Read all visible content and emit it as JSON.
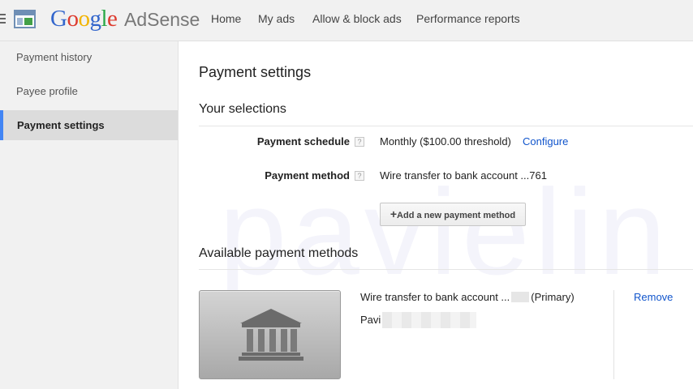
{
  "header": {
    "logo_letters": [
      "G",
      "o",
      "o",
      "g",
      "l",
      "e"
    ],
    "product": "AdSense",
    "nav": {
      "home": "Home",
      "my_ads": "My ads",
      "allow_block": "Allow & block ads",
      "performance": "Performance reports"
    }
  },
  "sidebar": {
    "items": [
      {
        "label": "Payment history",
        "active": false
      },
      {
        "label": "Payee profile",
        "active": false
      },
      {
        "label": "Payment settings",
        "active": true
      }
    ]
  },
  "main": {
    "title": "Payment settings",
    "watermark": "pavielin",
    "your_selections": {
      "heading": "Your selections",
      "schedule_label": "Payment schedule",
      "schedule_value": "Monthly ($100.00 threshold)",
      "configure_link": "Configure",
      "method_label": "Payment method",
      "method_value": "Wire transfer to bank account ...761",
      "help_glyph": "?",
      "add_button_plus": "+",
      "add_button_label": "Add a new payment method"
    },
    "available": {
      "heading": "Available payment methods",
      "method_title_prefix": "Wire transfer to bank account ...",
      "method_title_suffix": "(Primary)",
      "payee_name": "Pavi",
      "remove_link": "Remove"
    }
  },
  "colors": {
    "accent": "#4285f4",
    "link": "#1155cc"
  },
  "icons": [
    "hamburger-icon",
    "adsense-app-icon",
    "help-icon",
    "bank-icon"
  ]
}
